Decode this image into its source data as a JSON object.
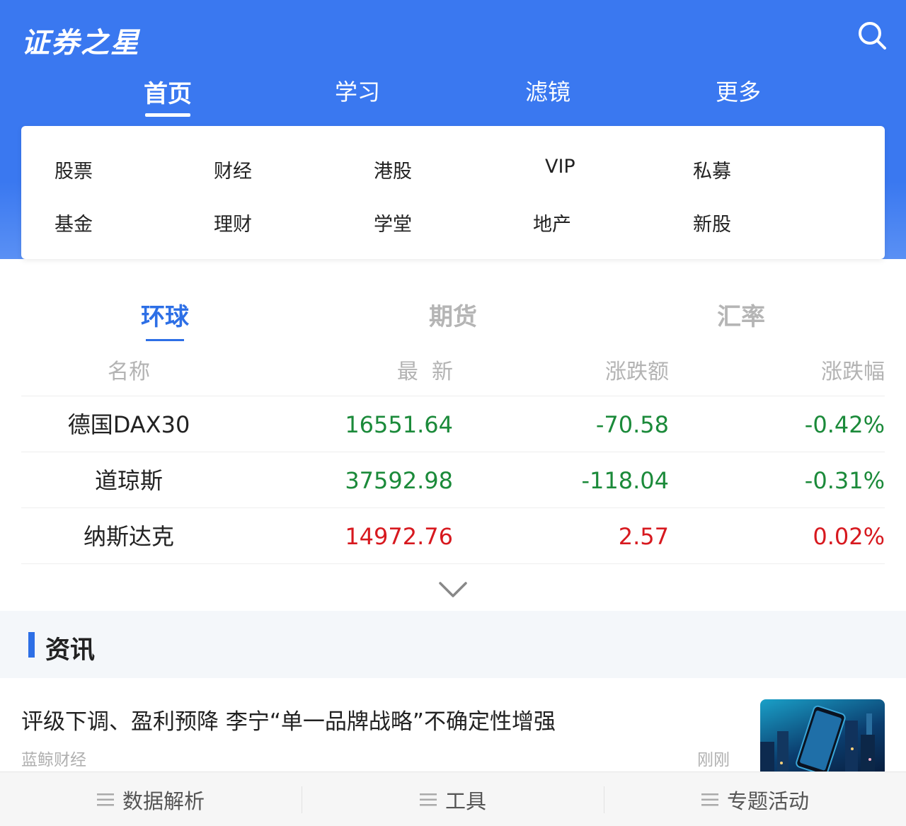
{
  "header": {
    "logo_text": "证券之星",
    "search_icon": "search-icon"
  },
  "nav": {
    "tabs": [
      {
        "label": "首页",
        "active": true
      },
      {
        "label": "学习",
        "active": false
      },
      {
        "label": "滤镜",
        "active": false
      },
      {
        "label": "更多",
        "active": false
      }
    ]
  },
  "menu": {
    "items": [
      "股票",
      "财经",
      "港股",
      "VIP",
      "私募",
      "基金",
      "理财",
      "学堂",
      "地产",
      "新股"
    ]
  },
  "market": {
    "tabs": [
      {
        "label": "环球",
        "active": true
      },
      {
        "label": "期货",
        "active": false
      },
      {
        "label": "汇率",
        "active": false
      }
    ],
    "columns": [
      "名称",
      "最  新",
      "涨跌额",
      "涨跌幅"
    ],
    "rows": [
      {
        "name": "德国DAX30",
        "latest": "16551.64",
        "change": "-70.58",
        "pct": "-0.42%",
        "direction": "down"
      },
      {
        "name": "道琼斯",
        "latest": "37592.98",
        "change": "-118.04",
        "pct": "-0.31%",
        "direction": "down"
      },
      {
        "name": "纳斯达克",
        "latest": "14972.76",
        "change": "2.57",
        "pct": "0.02%",
        "direction": "up"
      }
    ],
    "expand_icon": "chevron-down-icon"
  },
  "colors": {
    "brand": "#3a78f0",
    "accent": "#2d6fe6",
    "down": "#1b8a3a",
    "up": "#d7191f"
  },
  "news": {
    "section_title": "资讯",
    "articles": [
      {
        "title": "评级下调、盈利预降 李宁“单一品牌战略”不确定性增强",
        "source": "蓝鲸财经",
        "time": "刚刚"
      }
    ]
  },
  "bottom_bar": {
    "items": [
      "数据解析",
      "工具",
      "专题活动"
    ]
  }
}
